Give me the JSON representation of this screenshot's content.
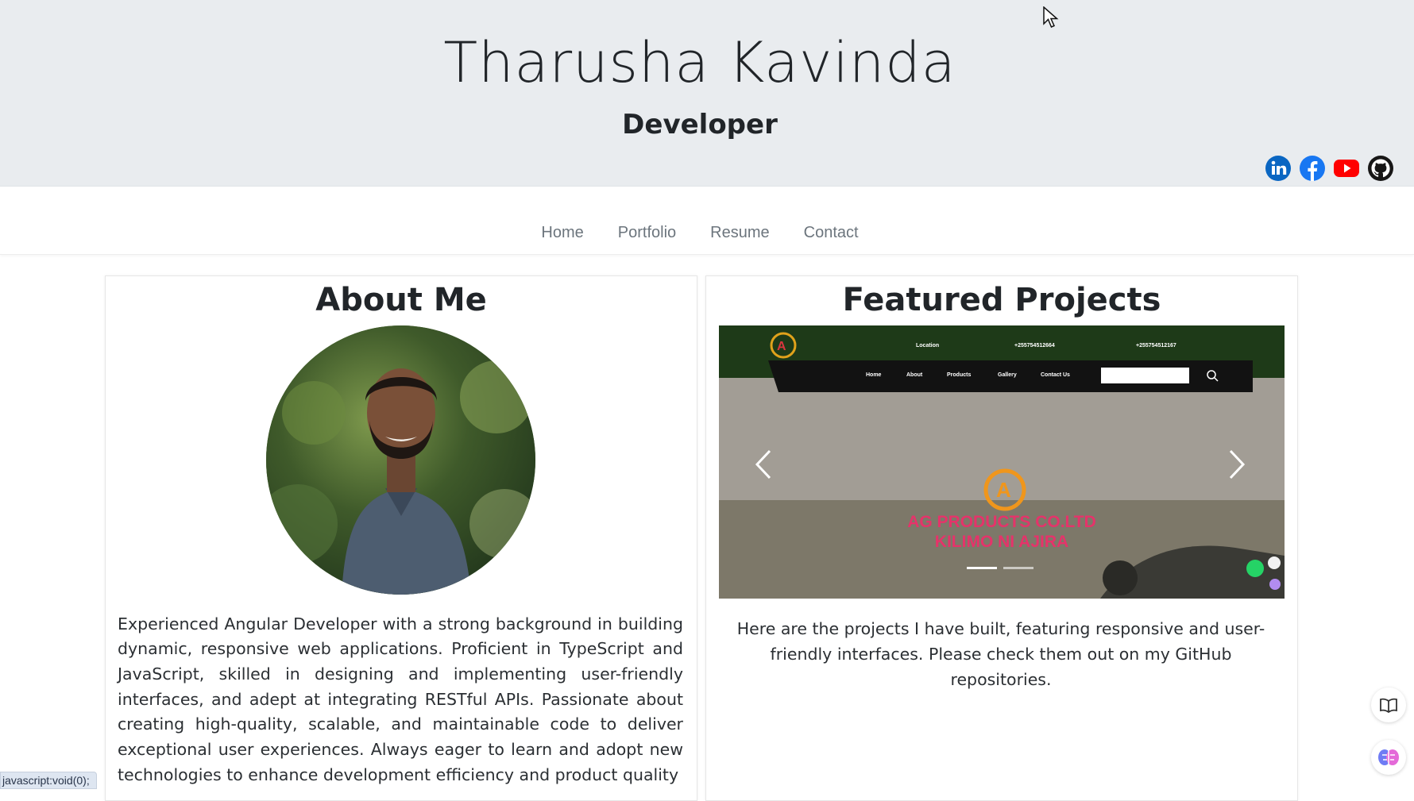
{
  "header": {
    "name": "Tharusha Kavinda",
    "role": "Developer",
    "social": [
      "linkedin-icon",
      "facebook-icon",
      "youtube-icon",
      "github-icon"
    ]
  },
  "nav": {
    "items": [
      "Home",
      "Portfolio",
      "Resume",
      "Contact"
    ]
  },
  "about": {
    "title": "About Me",
    "text": "Experienced Angular Developer with a strong background in building dynamic, responsive web applications. Proficient in TypeScript and JavaScript, skilled in designing and implementing user-friendly interfaces, and adept at integrating RESTful APIs. Passionate about creating high-quality, scalable, and maintainable code to deliver exceptional user experiences. Always eager to learn and adopt new technologies to enhance development efficiency and product quality"
  },
  "projects": {
    "title": "Featured Projects",
    "caption": "Here are the projects I have built, featuring responsive and user-friendly interfaces. Please check them out on my GitHub repositories.",
    "slide": {
      "topbar": {
        "location": "Location",
        "phone1": "+255754512664",
        "phone2": "+255754512167"
      },
      "menu": [
        "Home",
        "About",
        "Products",
        "Gallery",
        "Contact Us"
      ],
      "search_placeholder": "Search",
      "headline_1": "AG PRODUCTS CO.LTD",
      "headline_2": "KILIMO NI AJIRA"
    }
  },
  "status_bar": {
    "text": "javascript:void(0);"
  },
  "colors": {
    "header_bg": "#e9ecef",
    "nav_text": "#6c757d",
    "linkedin": "#0a66c2",
    "facebook": "#1877f2",
    "youtube": "#ff0000",
    "github": "#181717"
  }
}
